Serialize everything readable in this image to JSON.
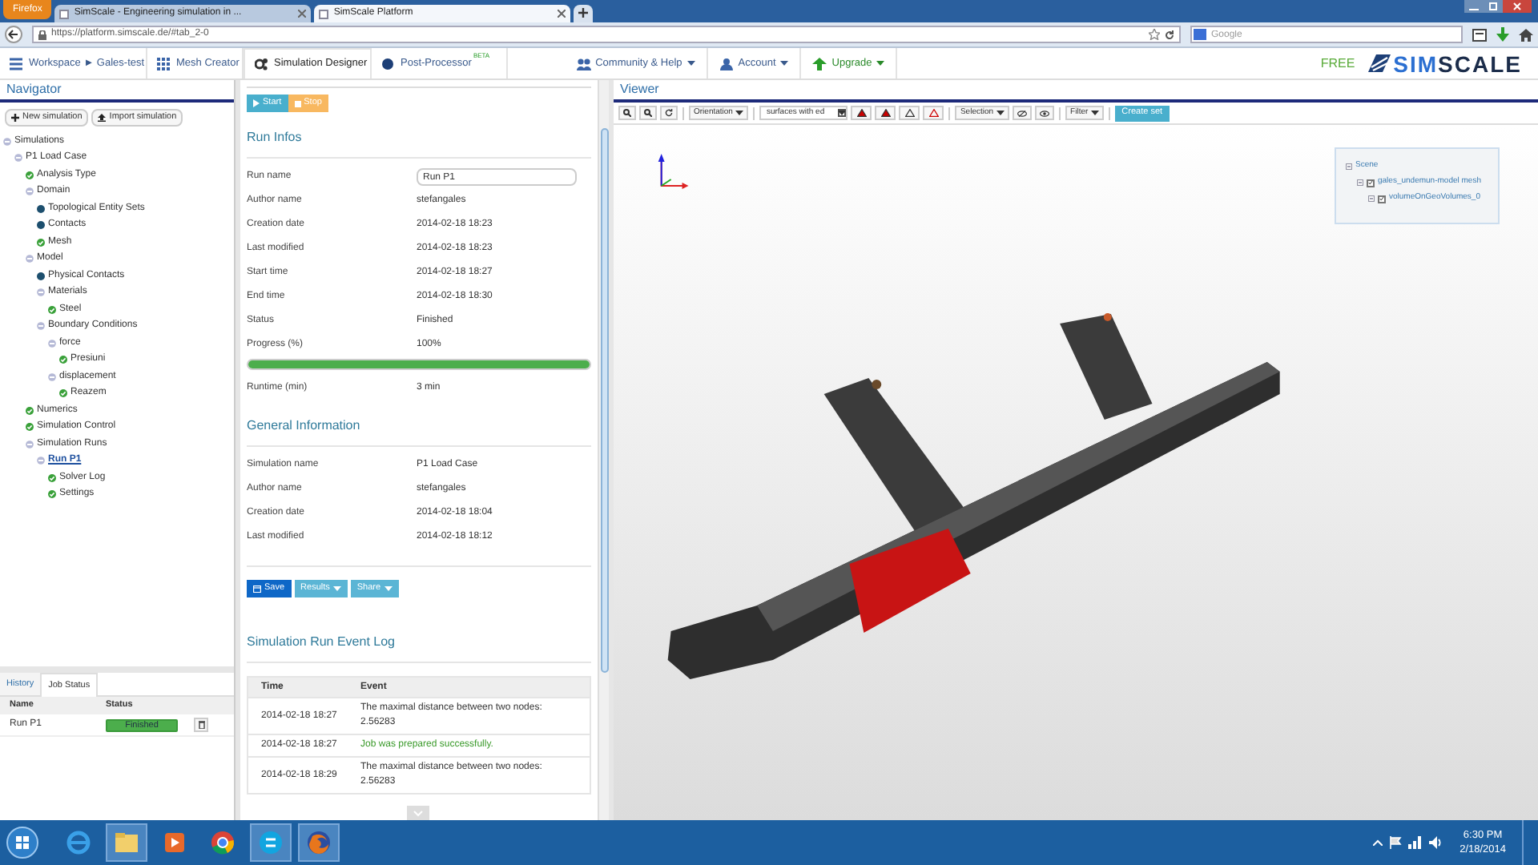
{
  "browser": {
    "menu_button": "Firefox",
    "tabs": [
      {
        "label": "SimScale - Engineering simulation in ...",
        "selected": false
      },
      {
        "label": "SimScale Platform",
        "selected": true
      }
    ],
    "url": "https://platform.simscale.de/#tab_2-0",
    "search_placeholder": "Google"
  },
  "app_nav": {
    "items": [
      {
        "label": "Workspace ► Gales-test",
        "kind": "workspace",
        "selected": false
      },
      {
        "label": "Mesh Creator",
        "kind": "mesh",
        "selected": false
      },
      {
        "label": "Simulation Designer",
        "kind": "designer",
        "selected": true
      },
      {
        "label": "Post-Processor",
        "kind": "post",
        "selected": false,
        "badge": "BETA"
      }
    ],
    "right_items": [
      {
        "label": "Community & Help",
        "kind": "community"
      },
      {
        "label": "Account",
        "kind": "account"
      },
      {
        "label": "Upgrade",
        "kind": "upgrade"
      }
    ],
    "plan": "FREE",
    "logo": [
      "SIM",
      "SCALE"
    ]
  },
  "navigator": {
    "title": "Navigator",
    "buttons": [
      "New simulation",
      "Import simulation"
    ],
    "tree": [
      {
        "label": "Simulations",
        "kind": "group",
        "children": [
          {
            "label": "P1 Load Case",
            "kind": "group",
            "children": [
              {
                "label": "Analysis Type",
                "kind": "ok"
              },
              {
                "label": "Domain",
                "kind": "group",
                "children": [
                  {
                    "label": "Topological Entity Sets",
                    "kind": "pending"
                  },
                  {
                    "label": "Contacts",
                    "kind": "pending"
                  },
                  {
                    "label": "Mesh",
                    "kind": "ok"
                  }
                ]
              },
              {
                "label": "Model",
                "kind": "group",
                "children": [
                  {
                    "label": "Physical Contacts",
                    "kind": "pending"
                  },
                  {
                    "label": "Materials",
                    "kind": "group",
                    "children": [
                      {
                        "label": "Steel",
                        "kind": "ok"
                      }
                    ]
                  },
                  {
                    "label": "Boundary Conditions",
                    "kind": "group",
                    "children": [
                      {
                        "label": "force",
                        "kind": "group",
                        "children": [
                          {
                            "label": "Presiuni",
                            "kind": "ok"
                          }
                        ]
                      },
                      {
                        "label": "displacement",
                        "kind": "group",
                        "children": [
                          {
                            "label": "Reazem",
                            "kind": "ok"
                          }
                        ]
                      }
                    ]
                  }
                ]
              },
              {
                "label": "Numerics",
                "kind": "ok"
              },
              {
                "label": "Simulation Control",
                "kind": "ok"
              },
              {
                "label": "Simulation Runs",
                "kind": "group",
                "children": [
                  {
                    "label": "Run P1",
                    "kind": "group",
                    "selected": true,
                    "children": [
                      {
                        "label": "Solver Log",
                        "kind": "ok"
                      },
                      {
                        "label": "Settings",
                        "kind": "ok"
                      }
                    ]
                  }
                ]
              }
            ]
          }
        ]
      }
    ]
  },
  "bottom_panel": {
    "tabs": [
      {
        "label": "History",
        "selected": false
      },
      {
        "label": "Job Status",
        "selected": true
      }
    ],
    "columns": [
      "Name",
      "Status"
    ],
    "rows": [
      {
        "name": "Run P1",
        "status": "Finished"
      }
    ]
  },
  "run_panel": {
    "buttons": [
      {
        "label": "Start",
        "kind": "start"
      },
      {
        "label": "Stop",
        "kind": "stop"
      }
    ],
    "run_infos": {
      "title": "Run Infos",
      "run_name_label": "Run name",
      "run_name": "Run P1",
      "fields": [
        [
          "Author name",
          "stefangales"
        ],
        [
          "Creation date",
          "2014-02-18 18:23"
        ],
        [
          "Last modified",
          "2014-02-18 18:23"
        ],
        [
          "Start time",
          "2014-02-18 18:27"
        ],
        [
          "End time",
          "2014-02-18 18:30"
        ],
        [
          "Status",
          "Finished"
        ],
        [
          "Progress (%)",
          "100%"
        ]
      ],
      "level": 1,
      "runtime_label": "Runtime (min)",
      "runtime": "3 min"
    },
    "general_information": {
      "title": "General Information",
      "fields": [
        [
          "Simulation name",
          "P1 Load Case"
        ],
        [
          "Author name",
          "stefangales"
        ],
        [
          "Creation date",
          "2014-02-18 18:04"
        ],
        [
          "Last modified",
          "2014-02-18 18:12"
        ]
      ]
    },
    "actions": [
      {
        "label": "Save",
        "kind": "save"
      },
      {
        "label": "Results",
        "kind": "menu"
      },
      {
        "label": "Share",
        "kind": "menu"
      }
    ],
    "event_log": {
      "title": "Simulation Run Event Log",
      "columns": [
        "Time",
        "Event"
      ],
      "rows": [
        {
          "time": "2014-02-18 18:27",
          "event": "The maximal distance between two nodes: 2.56283",
          "kind": "info"
        },
        {
          "time": "2014-02-18 18:27",
          "event": "Job was prepared successfully.",
          "kind": "success"
        },
        {
          "time": "2014-02-18 18:29",
          "event": "The maximal distance between two nodes: 2.56283",
          "kind": "info"
        }
      ]
    }
  },
  "viewer": {
    "title": "Viewer",
    "orientation": "Orientation",
    "render_mode": "surfaces with ed",
    "selection": "Selection",
    "filter": "Filter",
    "create_set": "Create set",
    "scene": {
      "label": "Scene",
      "children": [
        {
          "label": "gales_undemun-model mesh",
          "checked": true,
          "children": [
            {
              "label": "volumeOnGeoVolumes_0",
              "checked": true
            }
          ]
        }
      ]
    }
  },
  "taskbar": {
    "time": "6:30 PM",
    "date": "2/18/2014"
  }
}
